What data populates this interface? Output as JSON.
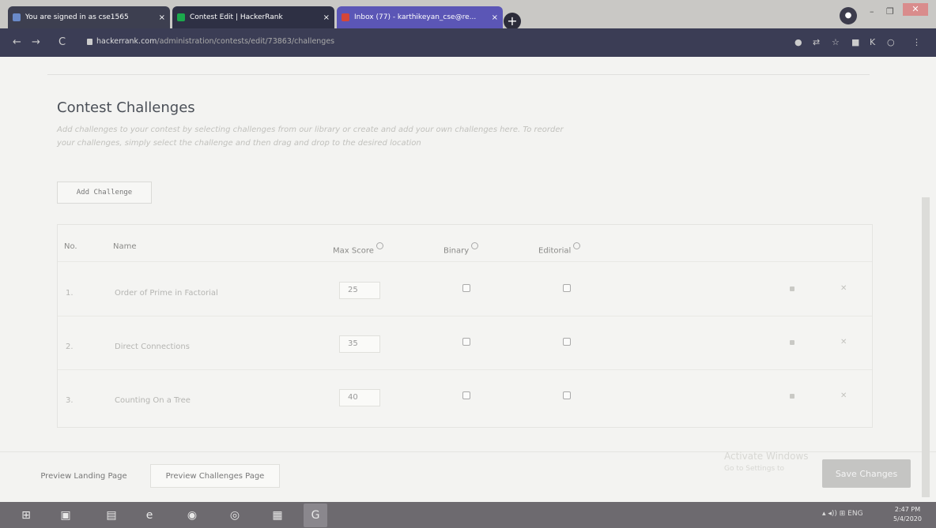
{
  "browser": {
    "tabs": [
      {
        "title": "You are signed in as cse1565",
        "close": "×"
      },
      {
        "title": "Contest Edit | HackerRank",
        "close": "×"
      },
      {
        "title": "Inbox (77) - karthikeyan_cse@re...",
        "close": "×"
      }
    ],
    "new_tab": "+",
    "url_host": "hackerrank.com",
    "url_path": "/administration/contests/edit/73863/challenges",
    "window_controls": {
      "min": "–",
      "max": "❐",
      "close": "✕"
    }
  },
  "page": {
    "title": "Contest Challenges",
    "description": "Add challenges to your contest by selecting challenges from our library or create and add your own challenges here. To reorder your challenges, simply select the challenge and then drag and drop to the desired location",
    "add_button": "Add Challenge",
    "columns": {
      "no": "No.",
      "name": "Name",
      "max_score": "Max Score",
      "binary": "Binary",
      "editorial": "Editorial"
    },
    "rows": [
      {
        "no": "1.",
        "name": "Order of Prime in Factorial",
        "score": "25"
      },
      {
        "no": "2.",
        "name": "Direct Connections",
        "score": "35"
      },
      {
        "no": "3.",
        "name": "Counting On a Tree",
        "score": "40"
      }
    ],
    "delete_glyph": "✕",
    "preview_landing": "Preview Landing Page",
    "preview_challenges": "Preview Challenges Page",
    "save_button": "Save Changes",
    "activate_line1": "Activate Windows",
    "activate_line2": "Go to Settings to"
  },
  "taskbar": {
    "tray": "▴ ◂)) ⊞ ENG",
    "time": "2:47 PM",
    "date": "5/4/2020"
  }
}
